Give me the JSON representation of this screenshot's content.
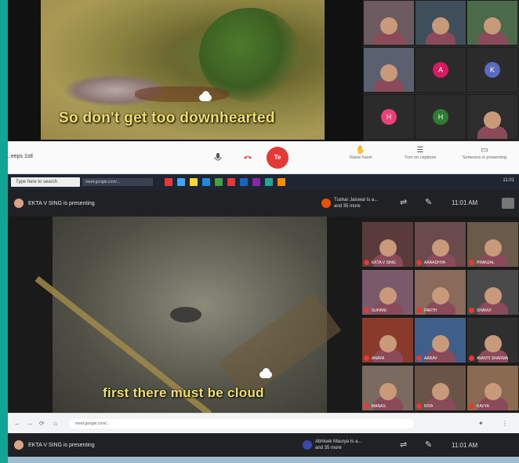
{
  "panel1": {
    "subtitle": "So don't get too downhearted",
    "tiles": [
      {
        "kind": "photo",
        "bg": "#6d5a60"
      },
      {
        "kind": "photo",
        "bg": "#3e4e5a"
      },
      {
        "kind": "photo",
        "bg": "#4a6a4a"
      },
      {
        "kind": "photo",
        "bg": "#5a6070"
      },
      {
        "kind": "avatar",
        "letter": "A",
        "color": "#d81b60"
      },
      {
        "kind": "avatar",
        "letter": "K",
        "color": "#5c6bc0"
      },
      {
        "kind": "avatar",
        "letter": "H",
        "color": "#ec407a"
      },
      {
        "kind": "avatar",
        "letter": "H",
        "color": "#2e7d32"
      },
      {
        "kind": "photo",
        "bg": "#2d2d2d"
      }
    ]
  },
  "toolbar": {
    "meeting_label": "...eeps 1stl",
    "end_label": "Te",
    "tools": [
      {
        "icon": "raise-hand-icon",
        "glyph": "✋",
        "label": "Raise hand"
      },
      {
        "icon": "captions-icon",
        "glyph": "☰",
        "label": "Turn on captions"
      },
      {
        "icon": "present-icon",
        "glyph": "▭",
        "label": "Someone is presenting"
      }
    ]
  },
  "taskbar": {
    "search_placeholder": "Type here to search",
    "url": "meet.google.com/...",
    "clock": "11:01"
  },
  "panel2": {
    "presenting": "EKTA V SING is presenting",
    "join_note": [
      "Tushar Jaiswal Is a...",
      "and 35 more"
    ],
    "time": "11:01 AM",
    "subtitle": "first there must be cloud",
    "tiles": [
      {
        "bg": "#5a3a3a",
        "label": "EKTA V SING"
      },
      {
        "bg": "#6a4a4a",
        "label": "AARADHYA"
      },
      {
        "bg": "#6a5a4a",
        "label": "PRANJAL"
      },
      {
        "bg": "#7a5a6a",
        "label": "SUHANI"
      },
      {
        "bg": "#8a6a5a",
        "label": "PARTH"
      },
      {
        "bg": "#4a4a4a",
        "label": "SHANVI"
      },
      {
        "bg": "#8a3a2a",
        "label": "ANAYA"
      },
      {
        "bg": "#3e5f8a",
        "label": "AARAV"
      },
      {
        "bg": "#2f2f2f",
        "label": "AVANTI SHARMA"
      },
      {
        "bg": "#7a6a60",
        "label": "MANAS"
      },
      {
        "bg": "#6a5448",
        "label": "RIYA"
      },
      {
        "bg": "#8a6a50",
        "label": "KAVYA"
      }
    ]
  },
  "chrome": {
    "url": "meet.google.com/..."
  },
  "panel3": {
    "presenting": "EKTA V SING is presenting",
    "join_note": [
      "Abhisek Maurya Is a...",
      "and 35 more"
    ],
    "time": "11:01 AM"
  },
  "colors": {
    "teal": "#12a495",
    "caption": "#f3e06a",
    "end_call": "#e53935"
  }
}
